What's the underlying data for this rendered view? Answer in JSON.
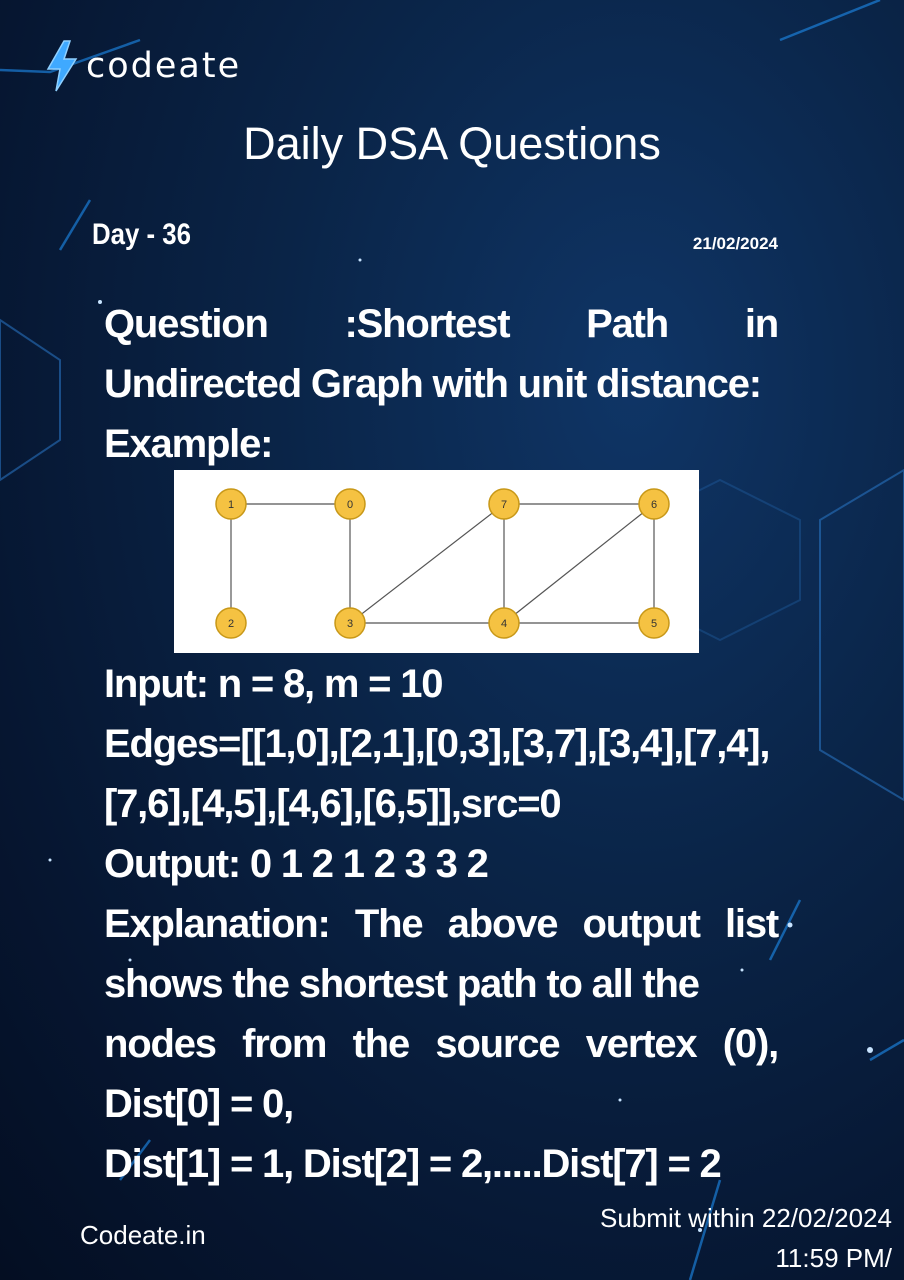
{
  "brand": {
    "name": "codeate",
    "icon": "lightning-bolt-icon",
    "accent": "#3fa9ff"
  },
  "header": {
    "title": "Daily DSA Questions",
    "day": "Day - 36",
    "date": "21/02/2024"
  },
  "question": {
    "line1_words": [
      "Question",
      ":Shortest",
      "Path",
      "in"
    ],
    "line2": "Undirected Graph with unit distance:",
    "example_label": "Example:"
  },
  "graph": {
    "nodes": [
      {
        "id": "1",
        "label": "1"
      },
      {
        "id": "0",
        "label": "0"
      },
      {
        "id": "7",
        "label": "7"
      },
      {
        "id": "6",
        "label": "6"
      },
      {
        "id": "2",
        "label": "2"
      },
      {
        "id": "3",
        "label": "3"
      },
      {
        "id": "4",
        "label": "4"
      },
      {
        "id": "5",
        "label": "5"
      }
    ],
    "edges": [
      [
        "1",
        "0"
      ],
      [
        "2",
        "1"
      ],
      [
        "0",
        "3"
      ],
      [
        "3",
        "7"
      ],
      [
        "3",
        "4"
      ],
      [
        "7",
        "4"
      ],
      [
        "7",
        "6"
      ],
      [
        "4",
        "5"
      ],
      [
        "4",
        "6"
      ],
      [
        "6",
        "5"
      ]
    ],
    "node_color": "#f5c242",
    "node_border": "#c89818"
  },
  "body": {
    "input": "Input: n = 8, m = 10",
    "edges1": "Edges=[[1,0],[2,1],[0,3],[3,7],[3,4],[7,4],",
    "edges2": "[7,6],[4,5],[4,6],[6,5]],src=0",
    "output": "Output: 0 1 2 1 2 3 3 2",
    "explanation1": "Explanation: The above output list",
    "explanation2": "shows the shortest path to all the",
    "explanation3": "nodes from the source vertex (0),",
    "dist0": "Dist[0] = 0,",
    "dist_rest": "Dist[1] = 1, Dist[2] = 2,.....Dist[7] = 2"
  },
  "footer": {
    "site": "Codeate.in",
    "submit1": "Submit within 22/02/2024",
    "submit2": "11:59 PM/"
  }
}
